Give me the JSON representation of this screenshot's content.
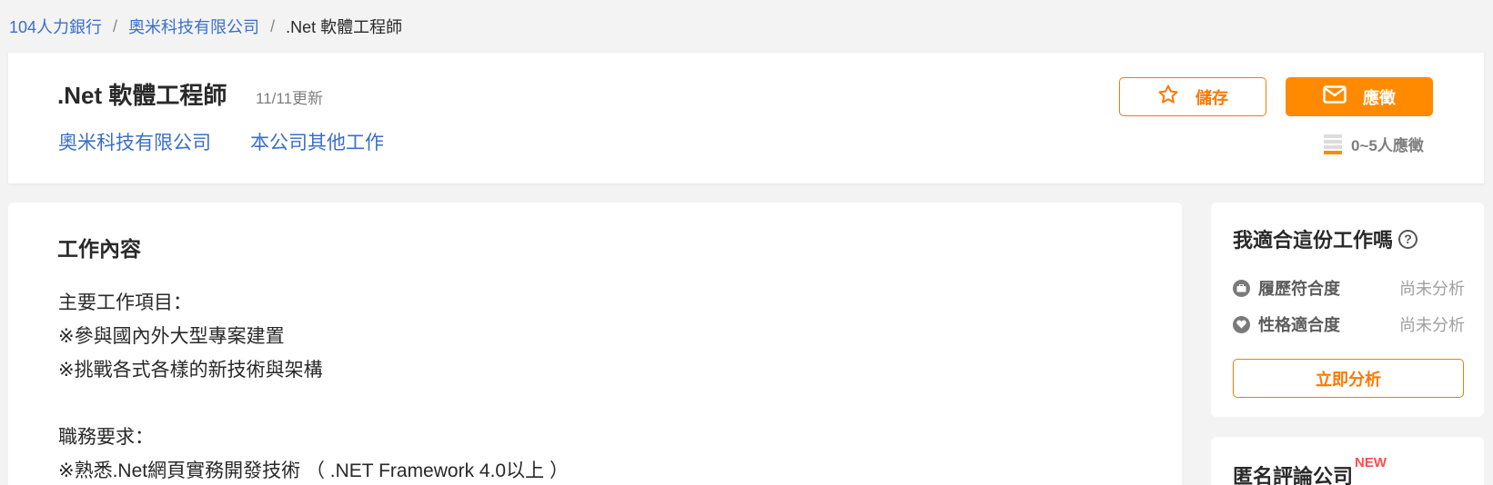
{
  "breadcrumb": {
    "home": "104人力銀行",
    "company": "奧米科技有限公司",
    "current": ".Net 軟體工程師",
    "separator": "/"
  },
  "job": {
    "title": ".Net 軟體工程師",
    "updated": "11/11更新",
    "company_link": "奧米科技有限公司",
    "other_jobs_link": "本公司其他工作"
  },
  "actions": {
    "save_label": "儲存",
    "apply_label": "應徵",
    "applicants": "0~5人應徵"
  },
  "content": {
    "section_title": "工作內容",
    "lines": [
      "主要工作項目：",
      "※參與國內外大型專案建置",
      "※挑戰各式各樣的新技術與架構",
      "",
      "職務要求：",
      "※熟悉.Net網頁實務開發技術 （ .NET Framework 4.0以上 ）"
    ]
  },
  "fit": {
    "title": "我適合這份工作嗎",
    "rows": [
      {
        "label": "履歷符合度",
        "value": "尚未分析",
        "icon": "briefcase-icon"
      },
      {
        "label": "性格適合度",
        "value": "尚未分析",
        "icon": "heart-icon"
      }
    ],
    "analyze_label": "立即分析"
  },
  "review": {
    "title": "匿名評論公司",
    "badge": "NEW"
  },
  "colors": {
    "accent": "#ff8a00",
    "link": "#3a6fc9",
    "background": "#f3f3f3"
  }
}
